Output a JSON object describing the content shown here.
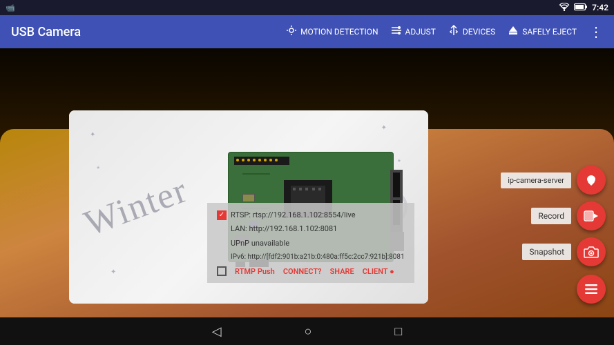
{
  "statusBar": {
    "time": "7:42",
    "wifiIcon": "wifi",
    "batteryIcon": "battery",
    "cameraIcon": "camera"
  },
  "appBar": {
    "title": "USB Camera",
    "actions": [
      {
        "id": "motion-detection",
        "label": "MOTION DETECTION",
        "icon": "🎯"
      },
      {
        "id": "adjust",
        "label": "ADJUST",
        "icon": "✏️"
      },
      {
        "id": "devices",
        "label": "DEVICES",
        "icon": "⚡"
      },
      {
        "id": "safely-eject",
        "label": "SAFELY EJECT",
        "icon": "⏏"
      },
      {
        "id": "more",
        "label": "",
        "icon": "⋮"
      }
    ]
  },
  "infoOverlay": {
    "rtspLabel": "RTSP: rtsp://192.168.1.102:8554/live",
    "lanLabel": "LAN: http://192.168.1.102:8081",
    "upnpLabel": "UPnP unavailable",
    "ipv6Label": "IPv6: http://[fdf2:901b:a21b:0:480a:ff5c:2cc7:921b]:8081",
    "checkboxRtspChecked": true,
    "checkboxBottomChecked": false,
    "actions": [
      {
        "id": "rtmp-push",
        "label": "RTMP Push"
      },
      {
        "id": "connect",
        "label": "CONNECT?"
      },
      {
        "id": "share",
        "label": "SHARE"
      },
      {
        "id": "client",
        "label": "CLIENT ●"
      }
    ]
  },
  "sideActions": [
    {
      "id": "ip-camera-server",
      "label": "IP Camera Server",
      "icon": "❤",
      "hasFab": true,
      "iconCode": "🚫"
    },
    {
      "id": "record",
      "label": "Record",
      "icon": "🎥",
      "hasFab": true
    },
    {
      "id": "snapshot",
      "label": "Snapshot",
      "icon": "📷",
      "hasFab": true
    },
    {
      "id": "menu",
      "label": "",
      "icon": "☰",
      "hasFab": true,
      "isBottom": true
    }
  ],
  "navBar": {
    "backIcon": "◁",
    "homeIcon": "○",
    "recentIcon": "□"
  }
}
